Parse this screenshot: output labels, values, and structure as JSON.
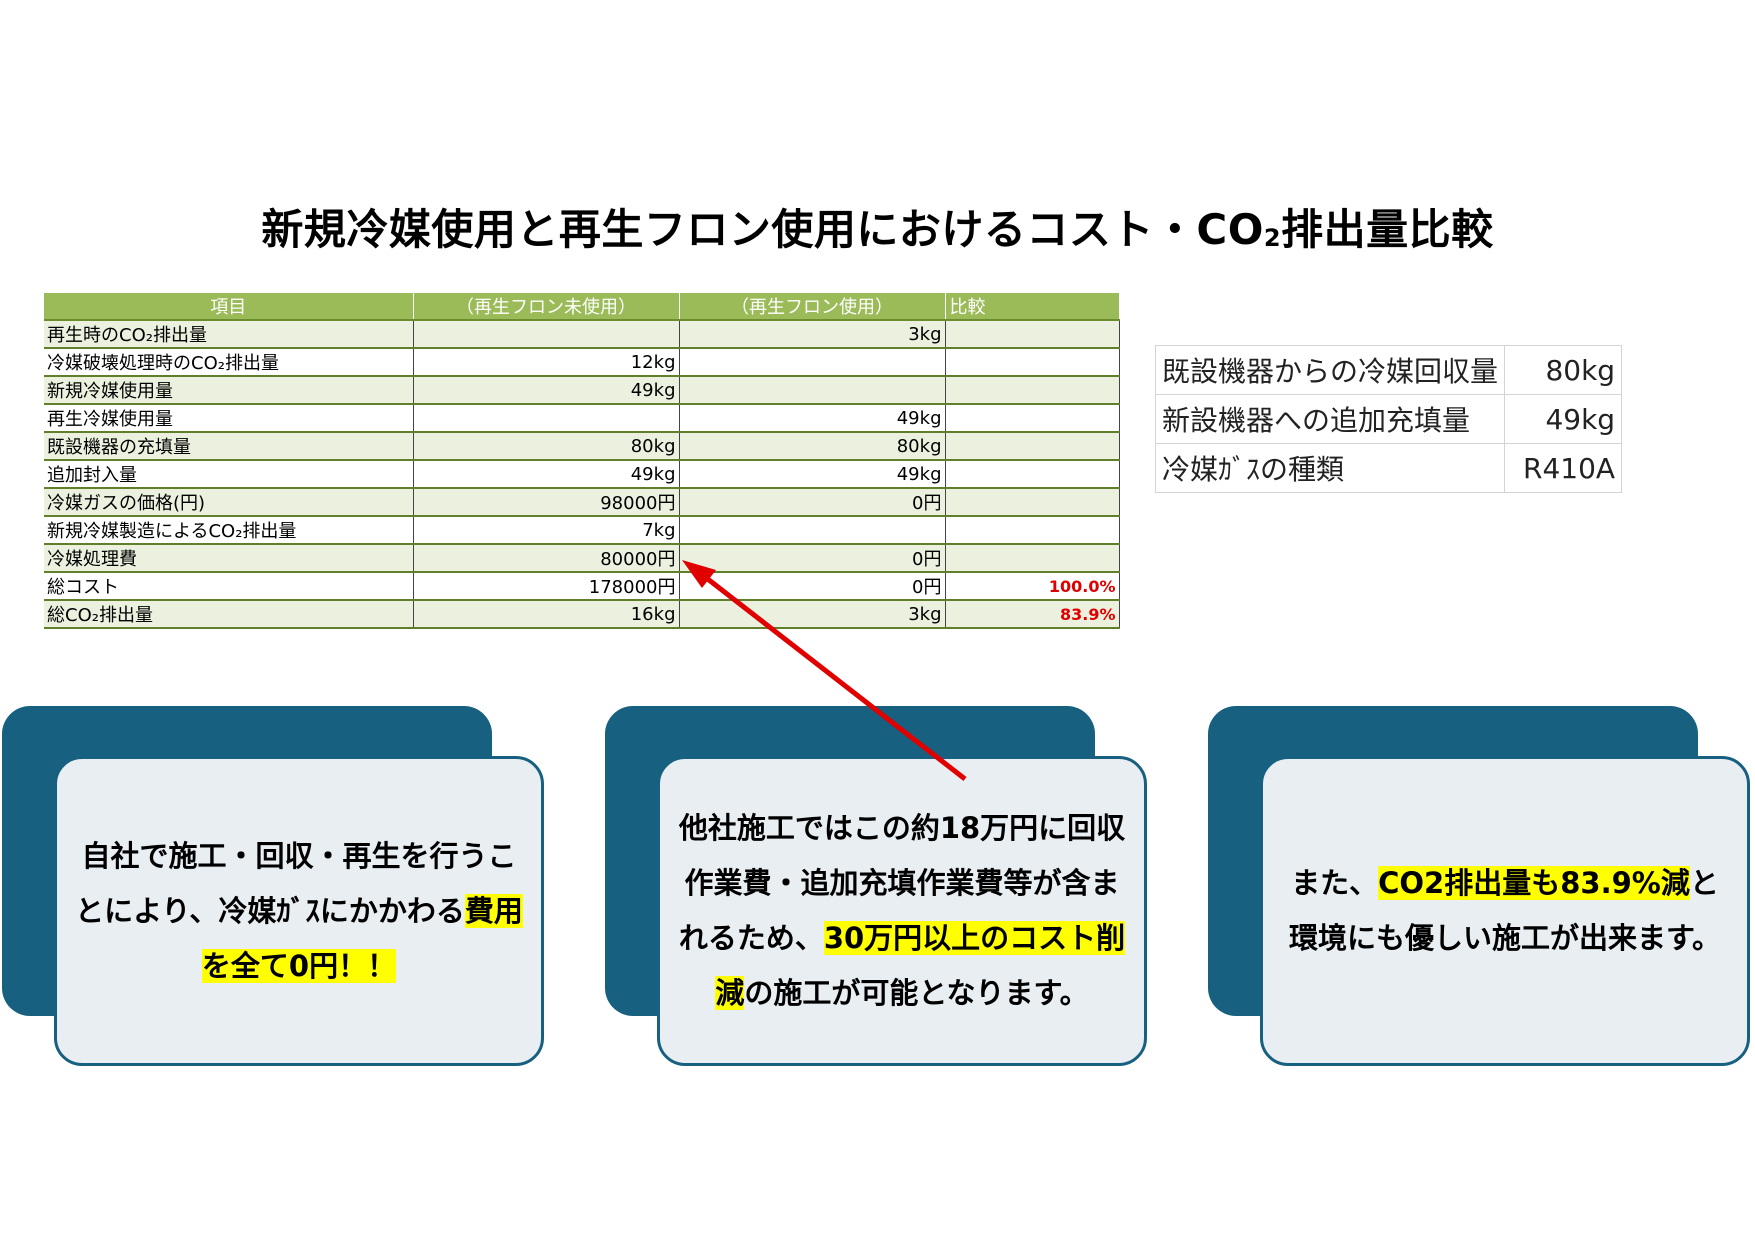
{
  "title": {
    "before": "新規冷媒使用と再生フロン使用におけるコスト・CO",
    "sub": "2",
    "after": "排出量比較"
  },
  "table": {
    "headers": [
      "項目",
      "（再生フロン未使用）",
      "（再生フロン使用）",
      "比較"
    ],
    "rows": [
      [
        "再生時のCO₂排出量",
        "",
        "3kg",
        ""
      ],
      [
        "冷媒破壊処理時のCO₂排出量",
        "12kg",
        "",
        ""
      ],
      [
        "新規冷媒使用量",
        "49kg",
        "",
        ""
      ],
      [
        "再生冷媒使用量",
        "",
        "49kg",
        ""
      ],
      [
        "既設機器の充填量",
        "80kg",
        "80kg",
        ""
      ],
      [
        "追加封入量",
        "49kg",
        "49kg",
        ""
      ],
      [
        "冷媒ガスの価格(円)",
        "98000円",
        "0円",
        ""
      ],
      [
        "新規冷媒製造によるCO₂排出量",
        "7kg",
        "",
        ""
      ],
      [
        "冷媒処理費",
        "80000円",
        "0円",
        ""
      ],
      [
        "総コスト",
        "178000円",
        "0円",
        "100.0%"
      ],
      [
        "総CO₂排出量",
        "16kg",
        "3kg",
        "83.9%"
      ]
    ]
  },
  "info": {
    "rows": [
      [
        "既設機器からの冷媒回収量",
        "80kg"
      ],
      [
        "新設機器への追加充填量",
        "49kg"
      ],
      [
        "冷媒ｶﾞｽの種類",
        "R410A"
      ]
    ]
  },
  "cards": {
    "card1": {
      "text1": "自社で施工・回収・再生を行うことにより、冷媒ｶﾞｽにかかわる",
      "hl1": "費用を全て0円！！"
    },
    "card2": {
      "text1": "他社施工ではこの約18万円に回収作業費・追加充填作業費等が含まれるため、",
      "hl1": "30万円以上のコスト削減",
      "text2": "の施工が可能となります。"
    },
    "card3": {
      "text1": "また、",
      "hl1": "CO2排出量も83.9%減",
      "text2": "と環境にも優しい施工が出来ます。"
    }
  },
  "colors": {
    "header_green": "#9bbb59",
    "card_blue": "#17607f",
    "highlight": "#ffff00",
    "arrow_red": "#e00000"
  }
}
